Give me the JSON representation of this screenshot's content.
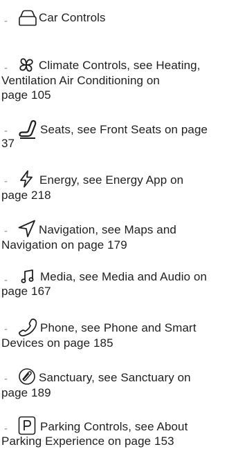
{
  "items": [
    {
      "dash": "-",
      "line1": "Car Controls",
      "line2": "",
      "icon": "car-icon"
    },
    {
      "dash": "-",
      "line1": "Climate Controls, see Heating,",
      "line2": "Ventilation Air Conditioning on",
      "line3": "page 105",
      "icon": "fan-icon"
    },
    {
      "dash": "-",
      "line1": "Seats, see Front Seats on page",
      "line2": "37",
      "icon": "seat-icon"
    },
    {
      "dash": "-",
      "line1": "Energy, see Energy App on",
      "line2": "page 218",
      "icon": "lightning-bolt-icon"
    },
    {
      "dash": "-",
      "line1": "Navigation, see Maps and",
      "line2": "Navigation on page 179",
      "icon": "navigation-arrow-icon"
    },
    {
      "dash": "-",
      "line1": "Media, see Media and Audio on",
      "line2": "page 167",
      "icon": "music-note-icon"
    },
    {
      "dash": "-",
      "line1": "Phone, see Phone and Smart",
      "line2": "Devices on page 185",
      "icon": "phone-icon"
    },
    {
      "dash": "-",
      "line1": "Sanctuary, see Sanctuary on",
      "line2": "page 189",
      "icon": "sanctuary-icon"
    },
    {
      "dash": "-",
      "line1": "Parking Controls, see About",
      "line2": "Parking Experience on page 153",
      "icon": "parking-icon"
    }
  ]
}
